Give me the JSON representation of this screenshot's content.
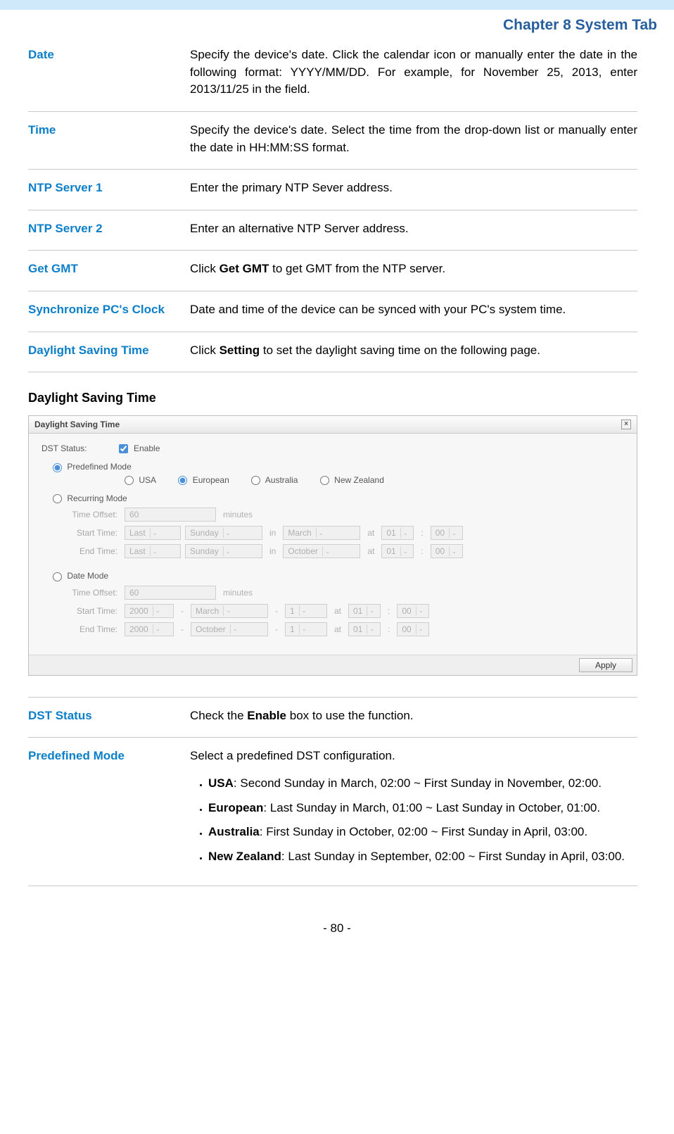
{
  "chapter": "Chapter 8 System Tab",
  "defs1": {
    "date": {
      "label": "Date",
      "desc": "Specify the device's date. Click the calendar icon or manually enter the date in the following format: YYYY/MM/DD. For example, for November 25, 2013, enter 2013/11/25 in the field."
    },
    "time": {
      "label": "Time",
      "desc": "Specify the device's date. Select the time from the drop-down list or manually enter the date in HH:MM:SS format."
    },
    "ntp1": {
      "label": "NTP Server 1",
      "desc": "Enter the primary NTP Sever address."
    },
    "ntp2": {
      "label": "NTP Server 2",
      "desc": "Enter an alternative NTP Server address."
    },
    "gmt": {
      "label": "Get GMT",
      "desc_pre": "Click ",
      "desc_bold": "Get GMT",
      "desc_post": " to get GMT from the NTP server."
    },
    "sync": {
      "label": "Synchronize PC's Clock",
      "desc": "Date and time of the device can be synced with your PC's system time."
    },
    "dst": {
      "label": "Daylight Saving Time",
      "desc_pre": "Click ",
      "desc_bold": "Setting",
      "desc_post": " to set the daylight saving time on the following page."
    }
  },
  "section_heading": "Daylight Saving Time",
  "panel": {
    "title": "Daylight Saving Time",
    "dst_status_label": "DST Status:",
    "enable_label": "Enable",
    "predefined_label": "Predefined Mode",
    "regions": {
      "usa": "USA",
      "european": "European",
      "australia": "Australia",
      "nz": "New Zealand"
    },
    "recurring_label": "Recurring Mode",
    "date_label": "Date Mode",
    "time_offset_label": "Time Offset:",
    "time_offset_value": "60",
    "minutes": "minutes",
    "start_time_label": "Start Time:",
    "end_time_label": "End Time:",
    "in": "in",
    "at": "at",
    "colon": ":",
    "dash": "-",
    "recurring": {
      "start": {
        "pos": "Last",
        "day": "Sunday",
        "month": "March",
        "hh": "01",
        "mm": "00"
      },
      "end": {
        "pos": "Last",
        "day": "Sunday",
        "month": "October",
        "hh": "01",
        "mm": "00"
      }
    },
    "date": {
      "start": {
        "year": "2000",
        "month": "March",
        "day": "1",
        "hh": "01",
        "mm": "00"
      },
      "end": {
        "year": "2000",
        "month": "October",
        "day": "1",
        "hh": "01",
        "mm": "00"
      }
    },
    "apply": "Apply"
  },
  "defs2": {
    "status": {
      "label": "DST Status",
      "desc_pre": "Check the ",
      "desc_bold": "Enable",
      "desc_post": " box to use the function."
    },
    "pre": {
      "label": "Predefined Mode",
      "intro": "Select a predefined DST configuration.",
      "usa_b": "USA",
      "usa_t": ": Second Sunday in March, 02:00 ~ First Sunday in November, 02:00.",
      "eu_b": "European",
      "eu_t": ": Last Sunday in March, 01:00 ~ Last Sunday in October, 01:00.",
      "au_b": "Australia",
      "au_t": ": First Sunday in October, 02:00 ~ First Sunday in April, 03:00.",
      "nz_b": "New Zealand",
      "nz_t": ": Last Sunday in September, 02:00 ~ First Sunday in April, 03:00."
    }
  },
  "page_number": "- 80 -"
}
